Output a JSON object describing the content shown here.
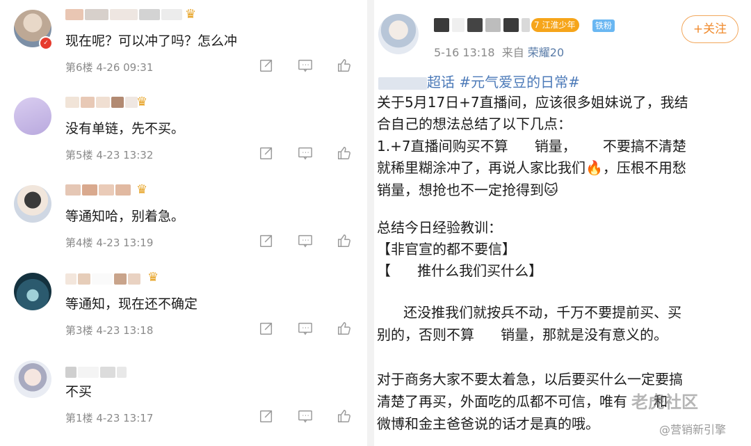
{
  "comments": [
    {
      "text": "现在呢？可以冲了吗？怎么冲",
      "floor": "第6楼",
      "time": "4-26 09:31"
    },
    {
      "text": "没有单链，先不买。",
      "floor": "第5楼",
      "time": "4-23 13:32"
    },
    {
      "text": "等通知哈，别着急。",
      "floor": "第4楼",
      "time": "4-23 13:19"
    },
    {
      "text": "等通知，现在还不确定",
      "floor": "第3楼",
      "time": "4-23 13:18"
    },
    {
      "text": "不买",
      "floor": "第1楼",
      "time": "4-23 13:17"
    }
  ],
  "post": {
    "level_tag": "江淮少年",
    "level_num": "7",
    "fan_tag": "铁粉",
    "follow_label": "+关注",
    "date": "5-16 13:18",
    "from_label": "来自",
    "source": "荣耀20",
    "topic": "超话 #元气爱豆的日常#",
    "lines": [
      "关于5月17日+7直播间，应该很多姐妹说了，我结",
      "合自己的想法总结了以下几点：",
      "1.+7直播间购买不算      销量，      不要搞不清楚",
      "就稀里糊涂冲了，再说人家比我们🔥，压根不用愁",
      "销量，想抢也不一定抢得到🐱",
      "",
      "总结今日经验教训：",
      "【非官宣的都不要信】",
      "【      推什么我们买什么】",
      "",
      "      还没推我们就按兵不动，千万不要提前买、买",
      "别的，否则不算      销量，那就是没有意义的。",
      "",
      "对于商务大家不要太着急，以后要买什么一定要搞",
      "清楚了再买，外面吃的瓜都不可信，唯有      和",
      "微博和金主爸爸说的话才是真的哦。"
    ],
    "watermark": "老虎社区",
    "credit": "@营销新引擎"
  },
  "colors": {
    "accent": "#f08a2c",
    "link": "#4c7ab8",
    "meta": "#8a8a8a"
  },
  "icons": [
    "share-icon",
    "comment-icon",
    "like-icon",
    "crown-icon"
  ]
}
